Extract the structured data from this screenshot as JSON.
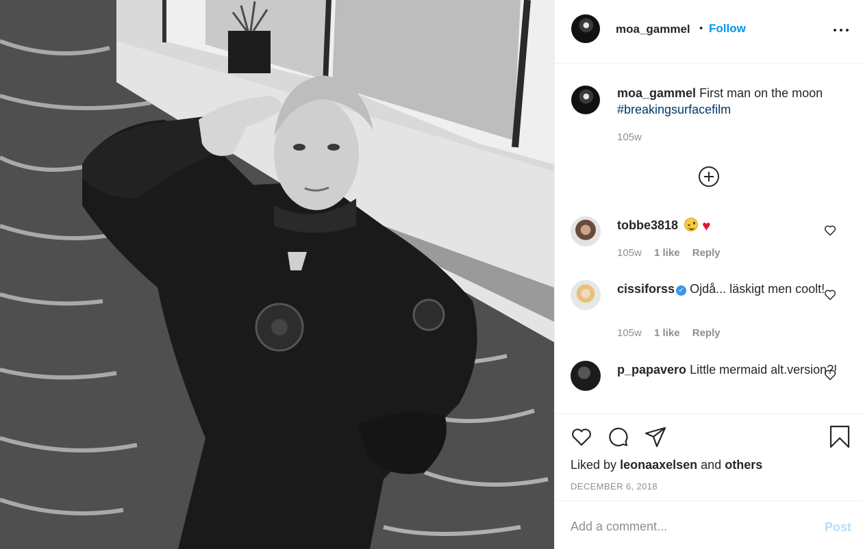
{
  "post": {
    "author": "moa_gammel",
    "dot": "•",
    "follow_label": "Follow",
    "photo_alt": "Black and white photo of a woman in a drysuit saluting while standing in an indoor pool"
  },
  "caption": {
    "username": "moa_gammel",
    "text": "First man on the moon",
    "hashtag": "#breakingsurfacefilm",
    "age": "105w"
  },
  "comments": [
    {
      "username": "tobbe3818",
      "text": "",
      "emojis": [
        "wink-emoji",
        "red-heart-emoji"
      ],
      "age": "105w",
      "likes": "1 like",
      "reply": "Reply"
    },
    {
      "username": "cissiforss",
      "verified": true,
      "text": "Ojdå... läskigt men coolt!",
      "age": "105w",
      "likes": "1 like",
      "reply": "Reply"
    },
    {
      "username": "p_papavero",
      "text": "Little mermaid alt.version?!"
    }
  ],
  "actions": {
    "icons": [
      "heart-icon",
      "comment-icon",
      "share-icon",
      "bookmark-icon"
    ],
    "liked_by_prefix": "Liked by",
    "liked_by_user": "leonaaxelsen",
    "liked_by_and": "and",
    "liked_by_others": "others",
    "date": "DECEMBER 6, 2018"
  },
  "add_comment": {
    "placeholder": "Add a comment...",
    "post_label": "Post"
  },
  "colors": {
    "accent": "#0095f6",
    "hashtag": "#00376b",
    "muted": "#8e8e8e",
    "post_disabled": "#b2dffc",
    "verified": "#3897f0",
    "heart_emoji": "#e0182d"
  }
}
